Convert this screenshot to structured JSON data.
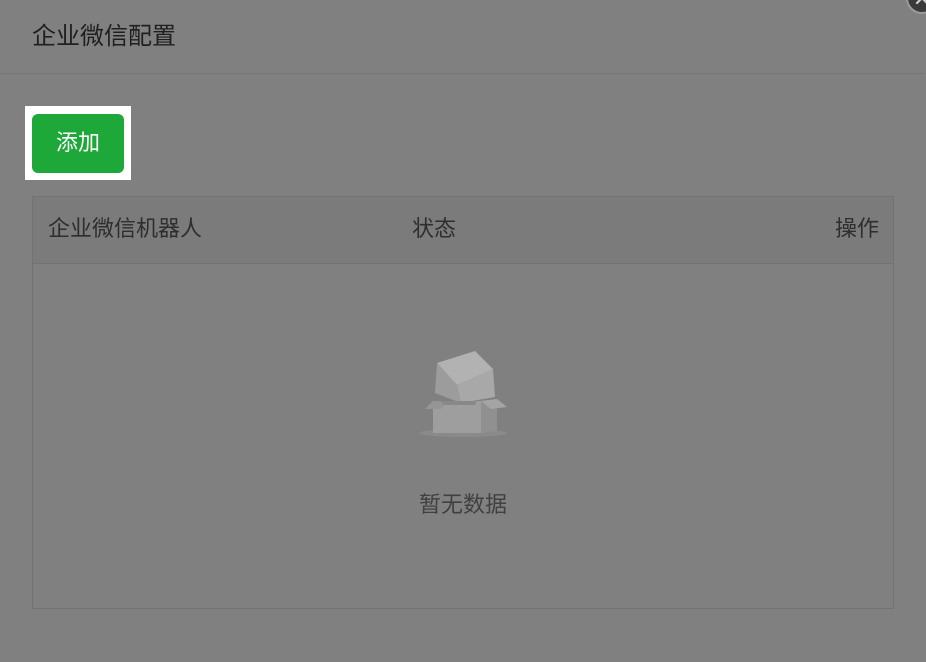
{
  "dialog": {
    "title": "企业微信配置"
  },
  "toolbar": {
    "add_label": "添加"
  },
  "table": {
    "columns": [
      "企业微信机器人",
      "状态",
      "操作"
    ],
    "rows": [],
    "empty_text": "暂无数据"
  },
  "colors": {
    "overlay": "#808080",
    "primary_button": "#1ea83a",
    "button_text": "#ffffff"
  },
  "icons": {
    "empty": "empty-box-icon",
    "close": "close-icon"
  }
}
